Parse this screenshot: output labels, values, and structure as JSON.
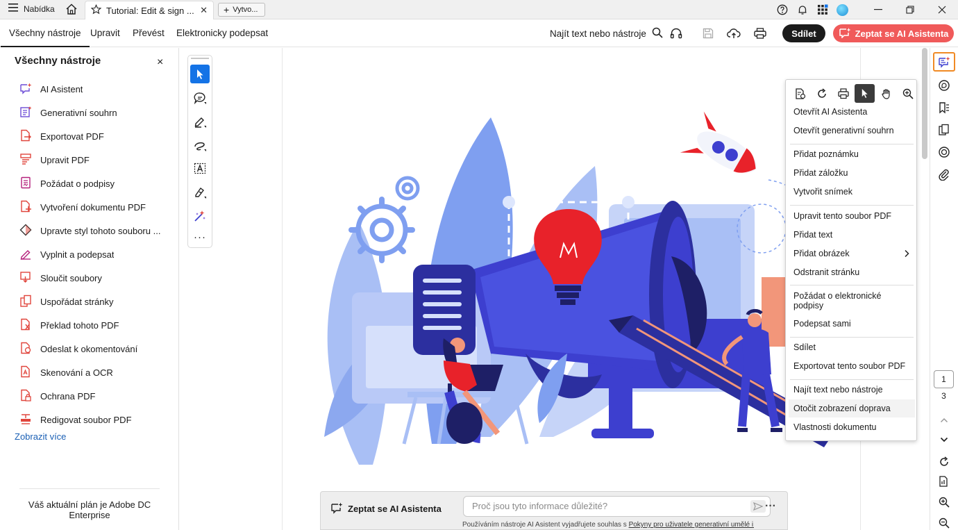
{
  "titlebar": {
    "menu_label": "Nabídka",
    "tab_title": "Tutorial: Edit & sign ...",
    "new_tab_label": "Vytvo..."
  },
  "menubar": {
    "tabs": [
      "Všechny nástroje",
      "Upravit",
      "Převést",
      "Elektronicky podepsat"
    ],
    "search_label": "Najít text nebo nástroje",
    "share_label": "Sdílet",
    "ai_label": "Zeptat se AI Asistenta"
  },
  "left_panel": {
    "title": "Všechny nástroje",
    "items": [
      {
        "label": "AI Asistent",
        "icon": "ai-assistant-icon"
      },
      {
        "label": "Generativní souhrn",
        "icon": "summary-icon"
      },
      {
        "label": "Exportovat PDF",
        "icon": "export-pdf-icon"
      },
      {
        "label": "Upravit PDF",
        "icon": "edit-pdf-icon"
      },
      {
        "label": "Požádat o podpisy",
        "icon": "request-signature-icon"
      },
      {
        "label": "Vytvoření dokumentu PDF",
        "icon": "create-pdf-icon"
      },
      {
        "label": "Upravte styl tohoto souboru ...",
        "icon": "style-icon"
      },
      {
        "label": "Vyplnit a podepsat",
        "icon": "fill-sign-icon"
      },
      {
        "label": "Sloučit soubory",
        "icon": "merge-icon"
      },
      {
        "label": "Uspořádat stránky",
        "icon": "organize-icon"
      },
      {
        "label": "Překlad tohoto PDF",
        "icon": "translate-icon"
      },
      {
        "label": "Odeslat k okomentování",
        "icon": "send-comment-icon"
      },
      {
        "label": "Skenování a OCR",
        "icon": "scan-ocr-icon"
      },
      {
        "label": "Ochrana PDF",
        "icon": "protect-icon"
      },
      {
        "label": "Redigovat soubor PDF",
        "icon": "redact-icon"
      }
    ],
    "show_more": "Zobrazit více",
    "plan_text": "Váš aktuální plán je Adobe DC Enterprise"
  },
  "context_menu": {
    "groups": [
      [
        "Otevřít AI Asistenta",
        "Otevřít generativní souhrn"
      ],
      [
        "Přidat poznámku",
        "Přidat záložku",
        "Vytvořit snímek"
      ],
      [
        "Upravit tento soubor PDF",
        "Přidat text",
        "Přidat obrázek",
        "Odstranit stránku"
      ],
      [
        "Požádat o elektronické podpisy",
        "Podepsat sami"
      ],
      [
        "Sdílet",
        "Exportovat tento soubor PDF"
      ],
      [
        "Najít text nebo nástroje",
        "Otočit zobrazení doprava",
        "Vlastnosti dokumentu"
      ]
    ],
    "highlighted": "Otočit zobrazení doprava"
  },
  "page_nav": {
    "current": "1",
    "total": "3"
  },
  "ai_bar": {
    "label": "Zeptat se AI Asistenta",
    "placeholder": "Proč jsou tyto informace důležité?",
    "note_prefix": "Používáním nástroje AI Asistent vyjadřujete souhlas s ",
    "note_link": "Pokyny pro uživatele generativní umělé i..."
  },
  "colors": {
    "accent_blue": "#1473e6",
    "ai_red": "#f05a5a",
    "illustration_blue": "#3d3fcf",
    "illustration_light": "#a9bff5"
  }
}
